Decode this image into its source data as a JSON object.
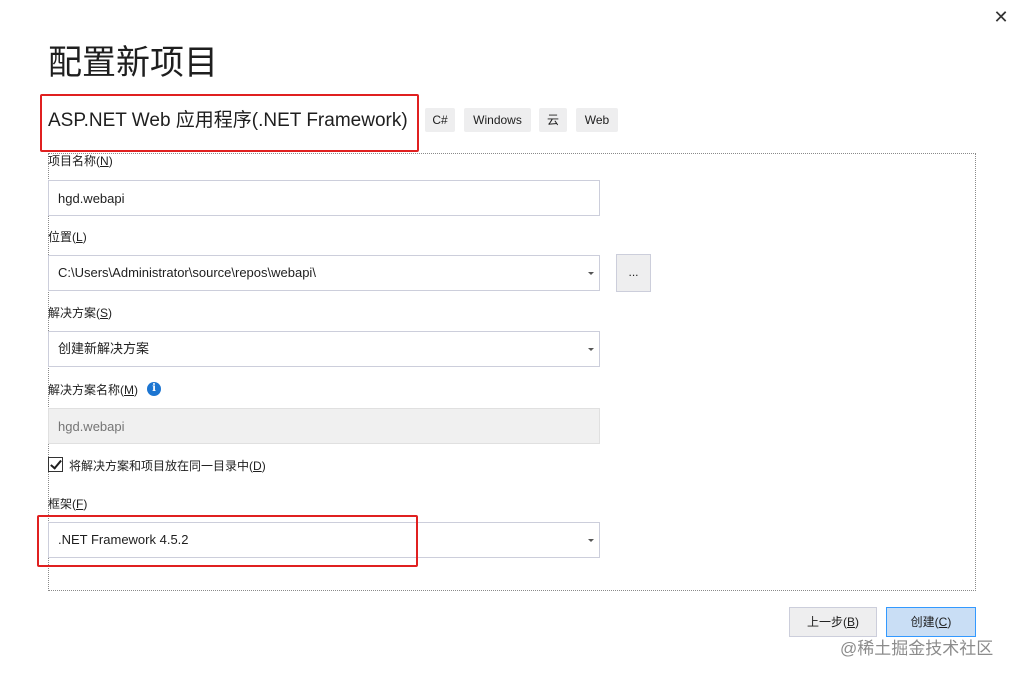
{
  "window": {
    "close_glyph": "✕"
  },
  "page_title": "配置新项目",
  "template": {
    "name": "ASP.NET Web 应用程序(.NET Framework)",
    "tags": [
      "C#",
      "Windows",
      "云",
      "Web"
    ]
  },
  "fields": {
    "project_name": {
      "label": "项目名称",
      "hotkey": "N",
      "value": "hgd.webapi"
    },
    "location": {
      "label": "位置",
      "hotkey": "L",
      "value": "C:\\Users\\Administrator\\source\\repos\\webapi\\",
      "browse_label": "..."
    },
    "solution": {
      "label": "解决方案",
      "hotkey": "S",
      "value": "创建新解决方案"
    },
    "solution_name": {
      "label": "解决方案名称",
      "hotkey": "M",
      "placeholder": "hgd.webapi",
      "info_icon": "info-icon"
    },
    "same_dir": {
      "label": "将解决方案和项目放在同一目录中",
      "hotkey": "D",
      "checked": true
    },
    "framework": {
      "label": "框架",
      "hotkey": "F",
      "value": ".NET Framework 4.5.2"
    }
  },
  "buttons": {
    "back": {
      "label": "上一步",
      "hotkey": "B"
    },
    "create": {
      "label": "创建",
      "hotkey": "C"
    }
  },
  "watermark": "@稀土掘金技术社区",
  "colors": {
    "highlight_box": "#e02020",
    "accent": "#3399ff",
    "info": "#1c75d1"
  }
}
